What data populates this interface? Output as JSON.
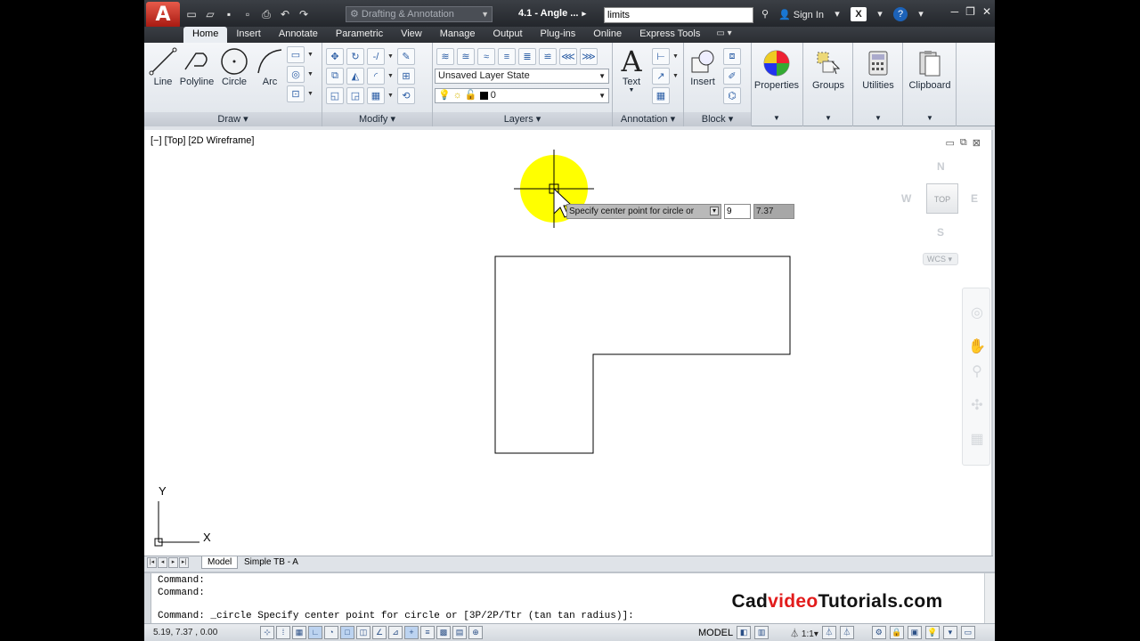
{
  "titlebar": {
    "workspace": "Drafting & Annotation",
    "doc_title": "4.1 - Angle ...",
    "search_value": "limits",
    "sign_in": "Sign In"
  },
  "tabs": [
    "Home",
    "Insert",
    "Annotate",
    "Parametric",
    "View",
    "Manage",
    "Output",
    "Plug-ins",
    "Online",
    "Express Tools"
  ],
  "ribbon": {
    "draw": {
      "title": "Draw",
      "tools": [
        "Line",
        "Polyline",
        "Circle",
        "Arc"
      ]
    },
    "modify": {
      "title": "Modify"
    },
    "layers": {
      "title": "Layers",
      "layer_state": "Unsaved Layer State",
      "current_layer": "0"
    },
    "annotation": {
      "title": "Annotation",
      "text_label": "Text"
    },
    "block": {
      "title": "Block",
      "insert_label": "Insert"
    },
    "properties": "Properties",
    "groups": "Groups",
    "utilities": "Utilities",
    "clipboard": "Clipboard"
  },
  "viewport": {
    "label": "[−] [Top] [2D Wireframe]",
    "viewcube": {
      "n": "N",
      "s": "S",
      "e": "E",
      "w": "W",
      "top": "TOP",
      "wcs": "WCS"
    },
    "ucs": {
      "x": "X",
      "y": "Y"
    }
  },
  "dynamic_input": {
    "prompt": "Specify center point for circle or",
    "x_value": "9",
    "y_value": "7.37"
  },
  "layout_tabs": [
    "Model",
    "Simple TB - A"
  ],
  "command": {
    "line1": "Command:",
    "line2": "Command:",
    "line3": "Command:  _circle Specify center point for circle or [3P/2P/Ttr (tan tan radius)]:"
  },
  "watermark": {
    "part1": "Cad",
    "part2": "video",
    "part3": "Tutorials.com"
  },
  "status": {
    "coords": "5.19, 7.37 , 0.00",
    "model": "MODEL",
    "scale": "1:1"
  },
  "colors": {
    "highlight": "#ffff00",
    "accent_red": "#e21b1b",
    "ribbon_bg": "#e9edf2"
  }
}
